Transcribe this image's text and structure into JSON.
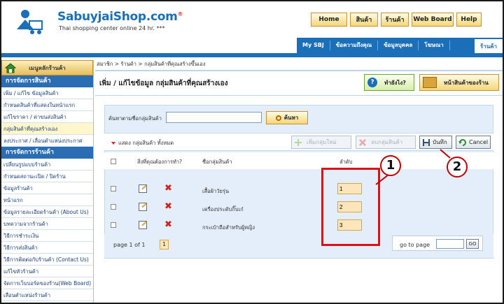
{
  "header": {
    "logo_text": "SabuyjaiShop.com",
    "logo_reg": "®",
    "logo_tagline": "Thai shopping center online 24 hr. ***",
    "topnav": [
      "Home",
      "สินค้า",
      "ร้านค้า",
      "Web Board",
      "Help"
    ],
    "subnav": [
      "My SBJ",
      "ข้อความถึงคุณ",
      "ข้อมูลบุคคล",
      "โฆษณา",
      "ร้านค้า"
    ]
  },
  "sidebar": {
    "menu_title": "เมนูหลักร้านค้า",
    "sections": [
      {
        "title": "การจัดการสินค้า",
        "items": [
          "เพิ่ม / แก้ไข ข้อมูลสินค้า",
          "กำหนดสินค้าที่แสดงในหน้าแรก",
          "แก้ไขราคา / ค่าขนส่งสินค้า",
          "กลุ่มสินค้าที่คุณสร้างเอง",
          "ลงประกาศ / เลื่อนตำแหน่งประกาศ"
        ]
      },
      {
        "title": "การจัดการร้านค้า",
        "items": [
          "เปลี่ยนรูปแบบร้านค้า",
          "กำหนดสถานะเปิด / ปิดร้าน",
          "ข้อมูลร้านค้า",
          "หน้าแรก",
          "ข้อมูลรายละเอียดร้านค้า (About Us)",
          "บทความจากร้านค้า",
          "วิธีการชำระเงิน",
          "วิธีการส่งสินค้า",
          "วิธีการติดต่อกับร้านค้า (Contact Us)",
          "แก้ไขหัวร้านค้า",
          "จัดการเว็บบอร์ดของร้าน(Web Board)",
          "เลื่อนตำแหน่งร้านค้า"
        ]
      }
    ]
  },
  "breadcrumb": "สมาชิก > ร้านค้า > กลุ่มสินค้าที่คุณสร้างขึ้นเอง",
  "page_title": "เพิ่ม / แก้ไขข้อมูล กลุ่มสินค้าที่คุณสร้างเอง",
  "help_button": "ทำยังไง?",
  "store_button": "หน้าสินค้าของร้าน",
  "search": {
    "label": "ค้นหาตามชื่อกลุ่มสินค้า",
    "value": "",
    "button": "ค้นหา"
  },
  "toolbar": {
    "show_all": "แสดง กลุ่มสินค้า ทั้งหมด",
    "add_label": "เพิ่มกลุ่มใหม่",
    "delete_label": "ลบกลุ่มสินค้า",
    "save_label": "บันทึก",
    "cancel_label": "Cancel"
  },
  "table": {
    "headers": [
      "สิ่งที่คุณต้องการทำ?",
      "ชื่อกลุ่มสินค้า",
      "ลำดับ"
    ],
    "rows": [
      {
        "name": "เสื้อผ้าวัยรุ่น",
        "order": "1"
      },
      {
        "name": "เครื่องประดับกิ๊บเก๋",
        "order": "2"
      },
      {
        "name": "กระเป๋าถือสำหรับผู้หญิง",
        "order": "3"
      }
    ]
  },
  "pager": {
    "text": "page 1 of 1",
    "current": "1",
    "goto_label": "go to page",
    "go_button": "GO"
  },
  "callouts": [
    "1",
    "2"
  ],
  "colors": {
    "accent": "#1b6fb8",
    "highlight": "#d11111",
    "order_field": "#fde6bb"
  }
}
